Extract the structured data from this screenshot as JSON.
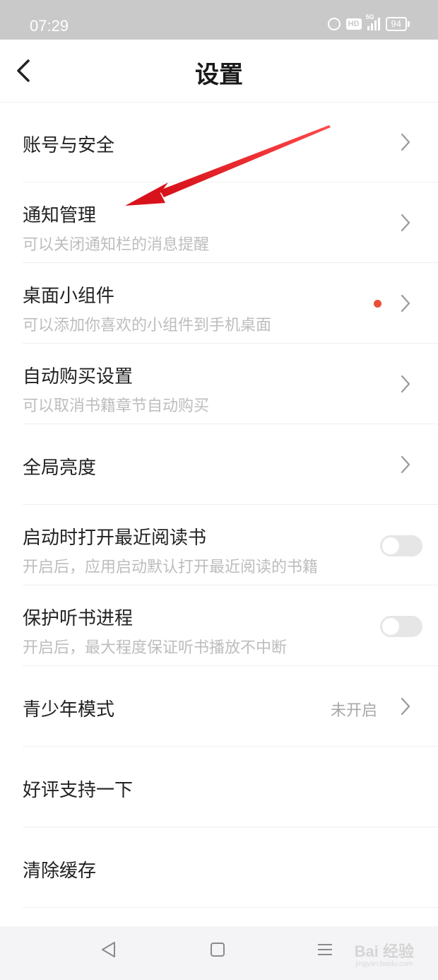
{
  "status_bar": {
    "time": "07:29",
    "network": "5G",
    "hd": "HD",
    "battery": "94"
  },
  "header": {
    "title": "设置"
  },
  "settings": {
    "account": {
      "title": "账号与安全"
    },
    "notify": {
      "title": "通知管理",
      "subtitle": "可以关闭通知栏的消息提醒"
    },
    "widget": {
      "title": "桌面小组件",
      "subtitle": "可以添加你喜欢的小组件到手机桌面",
      "badge_color": "#e8503a"
    },
    "autobuy": {
      "title": "自动购买设置",
      "subtitle": "可以取消书籍章节自动购买"
    },
    "brightness": {
      "title": "全局亮度"
    },
    "open_recent": {
      "title": "启动时打开最近阅读书",
      "subtitle": "开启后，应用启动默认打开最近阅读的书籍",
      "enabled": false
    },
    "protect_audio": {
      "title": "保护听书进程",
      "subtitle": "开启后，最大程度保证听书播放不中断",
      "enabled": false
    },
    "teen_mode": {
      "title": "青少年模式",
      "value": "未开启"
    },
    "rate": {
      "title": "好评支持一下"
    },
    "clear_cache": {
      "title": "清除缓存"
    }
  },
  "watermark": {
    "text": "Bai 经验",
    "url": "jingyan.baidu.com"
  },
  "colors": {
    "annotation_arrow": "#e0141c",
    "status_bar": "#c9c9c9"
  }
}
